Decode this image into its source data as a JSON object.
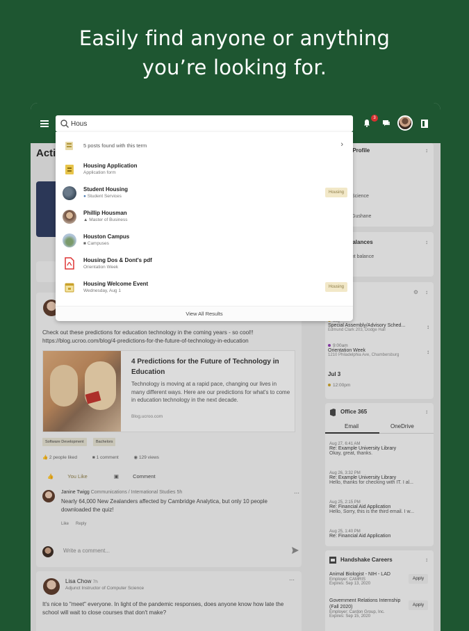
{
  "headline": {
    "line1": "Easily find anyone or anything",
    "line2": "you’re looking for."
  },
  "topbar": {
    "search_value": "Hous",
    "notif_count": "3"
  },
  "results": {
    "found_text": "5 posts found with this term",
    "items": [
      {
        "title": "Housing Application",
        "sub": "Application form",
        "badge": "",
        "icon": "form-icon"
      },
      {
        "title": "Student Housing",
        "sub": "Student Services",
        "badge": "Housing",
        "icon": "group-photo"
      },
      {
        "title": "Phillip Housman",
        "sub": "Master of Business",
        "badge": "",
        "icon": "person-photo"
      },
      {
        "title": "Houston Campus",
        "sub": "Campuses",
        "badge": "",
        "icon": "campus-photo"
      },
      {
        "title": "Housing Dos & Dont's pdf",
        "sub": "Orientation Week",
        "badge": "",
        "icon": "pdf-icon"
      },
      {
        "title": "Housing Welcome Event",
        "sub": "Wednesday, Aug 1",
        "badge": "Housing",
        "icon": "calendar-icon"
      }
    ],
    "view_all": "View All Results"
  },
  "feed": {
    "title": "Acti",
    "post1": {
      "text": "Check out these predictions for education technology in the coming years - so cool!! https://blog.ucroo.com/blog/4-predictions-for-the-future-of-technology-in-education",
      "link_title": "4 Predictions for the Future of Technology in Education",
      "link_desc": "Technology is moving at a rapid pace, changing our lives in many different ways. Here are our predictions for what's to come in education technology in the next decade.",
      "link_url": "Blog.ucroo.com",
      "tags": [
        "Software Development",
        "Bachelors"
      ],
      "likes": "2 people liked",
      "comments": "1 comment",
      "views": "129 views",
      "you_like": "You Like",
      "comment_btn": "Comment",
      "comment": {
        "name": "Janine Twigg",
        "role": "Communications / International Studies",
        "time": "5h",
        "body": "Nearly 64,000 New Zealanders affected by Cambridge Analytica, but only 10 people downloaded the quiz!",
        "like": "Like",
        "reply": "Reply"
      },
      "write_placeholder": "Write a comment..."
    },
    "post2": {
      "name": "Lisa Chow",
      "time": "7h",
      "role": "Adjunct Instructor of Computer Science",
      "body": "It's nice to \"meet\" everyone. In light of the pandemic responses, does anyone know how late the school will wait to close courses that don't make?"
    }
  },
  "sidebar": {
    "profile": {
      "title": "demic Profile",
      "line1": "Science",
      "line2": "Gushane"
    },
    "balances": {
      "title": "ount Balances",
      "line1": "ount balance"
    },
    "calendar": {
      "title": "ndar",
      "items": [
        {
          "time": "day",
          "name": "Special Assembly/Advisory Sched...",
          "loc": "Edmund Clark 203, Dodge Hall",
          "color": "#c9a12a"
        },
        {
          "time": "9:00am",
          "name": "Orientation Week",
          "loc": "1210 Philadelphia Ave, Chambersburg",
          "color": "#8e3bb0"
        }
      ],
      "date": "Jul 3",
      "time3": "12:00pm"
    },
    "office": {
      "title": "Office 365",
      "tab_email": "Email",
      "tab_onedrive": "OneDrive",
      "mails": [
        {
          "date": "Aug 27, 6:41 AM",
          "subject": "Re: Example University Library",
          "preview": "Okay, great, thanks."
        },
        {
          "date": "Aug 26, 3:32 PM",
          "subject": "Re: Example University Library",
          "preview": "Hello, thanks for checking with IT. I al..."
        },
        {
          "date": "Aug 25, 2:15 PM",
          "subject": "Re: Financial Aid Application",
          "preview": "Hello, Sorry, this is the third email. I w..."
        },
        {
          "date": "Aug 25, 1:40 PM",
          "subject": "Re: Financial Aid Application",
          "preview": ""
        }
      ]
    },
    "handshake": {
      "title": "Handshake Careers",
      "jobs": [
        {
          "title": "Animal Biologist - NIH - LAD",
          "employer": "Employer: CAMRIS",
          "expires": "Expires: Sep 13, 2020",
          "apply": "Apply"
        },
        {
          "title": "Government Relations Internship (Fall 2020)",
          "employer": "Employer: Cardon Group, Inc.",
          "expires": "Expires: Sep 15, 2020",
          "apply": "Apply"
        }
      ]
    }
  },
  "colors": {
    "brand_green": "#1e5631",
    "badge_bg": "#f2e8c8",
    "notif_red": "#d63131"
  }
}
